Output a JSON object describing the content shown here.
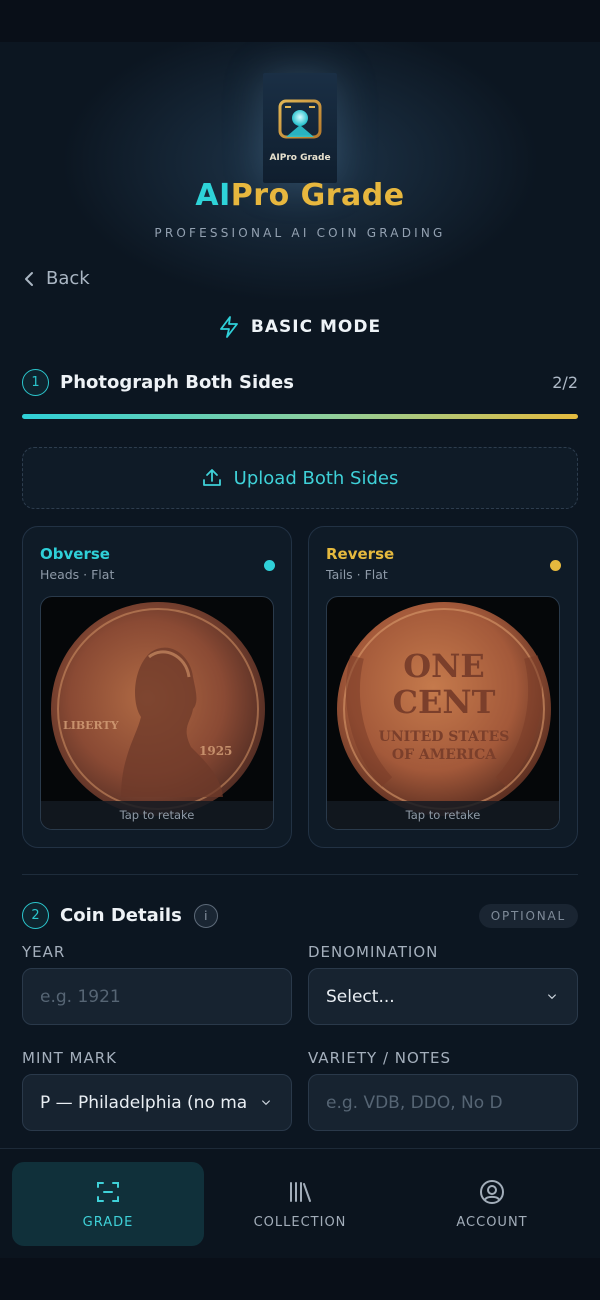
{
  "brand": {
    "logo_caption": "AIPro Grade",
    "name_part1": "AI",
    "name_part2": "Pro Grade",
    "tagline": "PROFESSIONAL AI COIN GRADING"
  },
  "nav": {
    "back_label": "Back"
  },
  "mode": {
    "label": "BASIC MODE",
    "icon": "lightning-icon"
  },
  "step1": {
    "number": "1",
    "title": "Photograph Both Sides",
    "count": "2/2",
    "progress": 1.0,
    "upload_label": "Upload Both Sides",
    "sides": [
      {
        "title": "Obverse",
        "subtitle": "Heads · Flat",
        "color": "#2fd0d8",
        "retake": "Tap to retake"
      },
      {
        "title": "Reverse",
        "subtitle": "Tails · Flat",
        "color": "#e5b93e",
        "retake": "Tap to retake"
      }
    ]
  },
  "step2": {
    "number": "2",
    "title": "Coin Details",
    "badge": "OPTIONAL",
    "fields": {
      "year": {
        "label": "YEAR",
        "placeholder": "e.g. 1921"
      },
      "denomination": {
        "label": "DENOMINATION",
        "value": "Select..."
      },
      "mint_mark": {
        "label": "MINT MARK",
        "value": "P — Philadelphia (no mark)"
      },
      "variety": {
        "label": "VARIETY / NOTES",
        "placeholder": "e.g. VDB, DDO, No D"
      }
    }
  },
  "tabs": [
    {
      "label": "GRADE",
      "icon": "scan-icon",
      "active": true
    },
    {
      "label": "COLLECTION",
      "icon": "library-icon",
      "active": false
    },
    {
      "label": "ACCOUNT",
      "icon": "user-circle-icon",
      "active": false
    }
  ],
  "colors": {
    "accent_teal": "#2fd0d8",
    "accent_gold": "#e5b93e",
    "background": "#0c1621"
  }
}
